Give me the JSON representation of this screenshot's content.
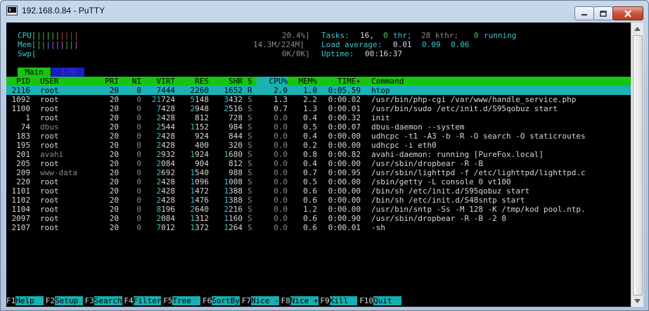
{
  "window": {
    "title": "192.168.0.84 - PuTTY"
  },
  "meters": {
    "cpu_label": "CPU[",
    "cpu_pct": "20.4%]",
    "mem_label": "Mem[",
    "mem_val": "14.3M/224M]",
    "swp_label": "Swp[",
    "swp_val": "0K/0K]"
  },
  "stats": {
    "tasks_label": "Tasks:",
    "tasks_count": "16,",
    "thr_count": "0",
    "thr_label": "thr;",
    "kthr": "28 kthr;",
    "running_count": "0",
    "running_label": "running",
    "load_label": "Load average:",
    "load1": "0.01",
    "load5": "0.09",
    "load15": "0.06",
    "uptime_label": "Uptime:",
    "uptime": "00:16:37"
  },
  "tabs": {
    "main": "Main",
    "io": "I/O"
  },
  "columns": [
    "PID",
    "USER",
    "PRI",
    "NI",
    "VIRT",
    "RES",
    "SHR",
    "S",
    "CPU%",
    "MEM%",
    "TIME+",
    "Command"
  ],
  "processes": [
    {
      "pid": "2116",
      "user": "root",
      "pri": "20",
      "ni": "0",
      "virt": "7444",
      "res": "2260",
      "shr": "1652",
      "s": "R",
      "cpu": "2.0",
      "mem": "1.0",
      "time": "0:05.59",
      "cmd": "htop",
      "selected": true
    },
    {
      "pid": "1092",
      "user": "root",
      "pri": "20",
      "ni": "0",
      "virt": "21724",
      "res": "5148",
      "shr": "3432",
      "s": "S",
      "cpu": "1.3",
      "mem": "2.2",
      "time": "0:00.02",
      "cmd": "/usr/bin/php-cgi /var/www/handle_service.php"
    },
    {
      "pid": "1100",
      "user": "root",
      "pri": "20",
      "ni": "0",
      "virt": "7428",
      "res": "2948",
      "shr": "2516",
      "s": "S",
      "cpu": "0.7",
      "mem": "1.3",
      "time": "0:00.01",
      "cmd": "/usr/bin/sudo /etc/init.d/S95qobuz start"
    },
    {
      "pid": "1",
      "user": "root",
      "pri": "20",
      "ni": "0",
      "virt": "2428",
      "res": "812",
      "shr": "728",
      "s": "S",
      "cpu": "0.0",
      "mem": "0.4",
      "time": "0:00.32",
      "cmd": "init"
    },
    {
      "pid": "74",
      "user": "dbus",
      "pri": "20",
      "ni": "0",
      "virt": "2544",
      "res": "1152",
      "shr": "984",
      "s": "S",
      "cpu": "0.0",
      "mem": "0.5",
      "time": "0:00.07",
      "cmd": "dbus-daemon --system"
    },
    {
      "pid": "183",
      "user": "root",
      "pri": "20",
      "ni": "0",
      "virt": "2428",
      "res": "924",
      "shr": "844",
      "s": "S",
      "cpu": "0.0",
      "mem": "0.4",
      "time": "0:00.00",
      "cmd": "udhcpc -t1 -A3 -b -R -O search -O staticroutes"
    },
    {
      "pid": "195",
      "user": "root",
      "pri": "20",
      "ni": "0",
      "virt": "2428",
      "res": "400",
      "shr": "320",
      "s": "S",
      "cpu": "0.0",
      "mem": "0.2",
      "time": "0:00.00",
      "cmd": "udhcpc -i eth0"
    },
    {
      "pid": "201",
      "user": "avahi",
      "pri": "20",
      "ni": "0",
      "virt": "2932",
      "res": "1924",
      "shr": "1680",
      "s": "S",
      "cpu": "0.0",
      "mem": "0.8",
      "time": "0:00.82",
      "cmd": "avahi-daemon: running [PureFox.local]"
    },
    {
      "pid": "205",
      "user": "root",
      "pri": "20",
      "ni": "0",
      "virt": "2084",
      "res": "904",
      "shr": "812",
      "s": "S",
      "cpu": "0.0",
      "mem": "0.4",
      "time": "0:00.00",
      "cmd": "/usr/sbin/dropbear -R -B"
    },
    {
      "pid": "209",
      "user": "www-data",
      "pri": "20",
      "ni": "0",
      "virt": "2692",
      "res": "1540",
      "shr": "988",
      "s": "S",
      "cpu": "0.0",
      "mem": "0.7",
      "time": "0:00.95",
      "cmd": "/usr/sbin/lighttpd -f /etc/lighttpd/lighttpd.c"
    },
    {
      "pid": "220",
      "user": "root",
      "pri": "20",
      "ni": "0",
      "virt": "2428",
      "res": "1096",
      "shr": "1008",
      "s": "S",
      "cpu": "0.0",
      "mem": "0.5",
      "time": "0:00.00",
      "cmd": "/sbin/getty -L console 0 vt100"
    },
    {
      "pid": "1101",
      "user": "root",
      "pri": "20",
      "ni": "0",
      "virt": "2428",
      "res": "1472",
      "shr": "1388",
      "s": "S",
      "cpu": "0.0",
      "mem": "0.6",
      "time": "0:00.00",
      "cmd": "/bin/sh /etc/init.d/S95qobuz start"
    },
    {
      "pid": "1102",
      "user": "root",
      "pri": "20",
      "ni": "0",
      "virt": "2428",
      "res": "1476",
      "shr": "1388",
      "s": "S",
      "cpu": "0.0",
      "mem": "0.6",
      "time": "0:00.00",
      "cmd": "/bin/sh /etc/init.d/S48sntp start"
    },
    {
      "pid": "1104",
      "user": "root",
      "pri": "20",
      "ni": "0",
      "virt": "8196",
      "res": "2640",
      "shr": "2216",
      "s": "S",
      "cpu": "0.0",
      "mem": "1.2",
      "time": "0:00.00",
      "cmd": "/usr/bin/sntp -Ss -M 128 -K /tmp/kod pool.ntp."
    },
    {
      "pid": "2097",
      "user": "root",
      "pri": "20",
      "ni": "0",
      "virt": "2084",
      "res": "1312",
      "shr": "1160",
      "s": "S",
      "cpu": "0.0",
      "mem": "0.6",
      "time": "0:00.90",
      "cmd": "/usr/sbin/dropbear -R -B -2 8"
    },
    {
      "pid": "2107",
      "user": "root",
      "pri": "20",
      "ni": "0",
      "virt": "7012",
      "res": "1372",
      "shr": "1264",
      "s": "S",
      "cpu": "0.0",
      "mem": "0.6",
      "time": "0:00.01",
      "cmd": "-sh"
    }
  ],
  "fkeys": [
    {
      "key": "F1",
      "label": "Help  "
    },
    {
      "key": "F2",
      "label": "Setup "
    },
    {
      "key": "F3",
      "label": "Search"
    },
    {
      "key": "F4",
      "label": "Filter"
    },
    {
      "key": "F5",
      "label": "Tree  "
    },
    {
      "key": "F6",
      "label": "SortBy"
    },
    {
      "key": "F7",
      "label": "Nice -"
    },
    {
      "key": "F8",
      "label": "Nice +"
    },
    {
      "key": "F9",
      "label": "Kill  "
    },
    {
      "key": "F10",
      "label": "Quit  "
    }
  ],
  "colors": {
    "header_bg": "#17c50f",
    "selected_bg": "#1ab2b4",
    "fkey_bg": "#16afb2",
    "terminal_bg": "#000000"
  },
  "icons": {
    "app": "putty-terminal-icon"
  }
}
